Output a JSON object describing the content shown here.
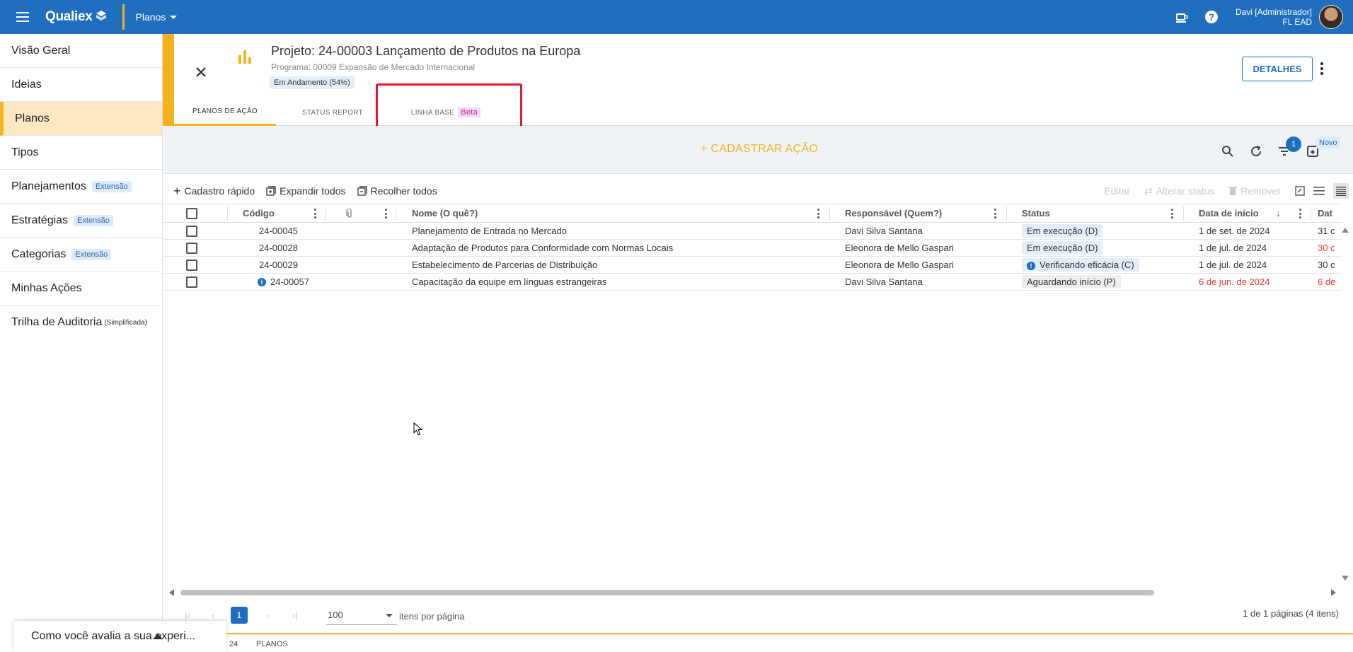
{
  "topbar": {
    "brand": "Qualiex",
    "module": "Planos",
    "user_name": "Davi [Administrador]",
    "user_org": "FL EAD",
    "icons": [
      "menu-icon",
      "coffee-icon",
      "help-icon"
    ]
  },
  "sidebar": {
    "items": [
      {
        "label": "Visão Geral",
        "badge": "",
        "note": ""
      },
      {
        "label": "Ideias",
        "badge": "",
        "note": ""
      },
      {
        "label": "Planos",
        "badge": "",
        "note": "",
        "active": true
      },
      {
        "label": "Tipos",
        "badge": "",
        "note": ""
      },
      {
        "label": "Planejamentos",
        "badge": "Extensão",
        "note": ""
      },
      {
        "label": "Estratégias",
        "badge": "Extensão",
        "note": ""
      },
      {
        "label": "Categorias",
        "badge": "Extensão",
        "note": ""
      },
      {
        "label": "Minhas Ações",
        "badge": "",
        "note": ""
      },
      {
        "label": "Trilha de Auditoria",
        "badge": "",
        "note": "(Simplificada)"
      }
    ]
  },
  "project": {
    "title": "Projeto: 24-00003 Lançamento de Produtos na Europa",
    "subtitle": "Programa: 00009 Expansão de Mercado Internacional",
    "status": "Em Andamento (54%)",
    "details_label": "DETALHES",
    "tabs": [
      {
        "label": "PLANOS DE AÇÃO",
        "active": true,
        "badge": ""
      },
      {
        "label": "STATUS REPORT",
        "active": false,
        "badge": ""
      },
      {
        "label": "LINHA BASE",
        "active": false,
        "badge": "Beta"
      }
    ]
  },
  "actions": {
    "cadastrar": "+ CADASTRAR AÇÃO",
    "filter_count": "1",
    "novo": "Novo"
  },
  "toolbar": {
    "quick_add": "Cadastro rápido",
    "expand_all": "Expandir todos",
    "collapse_all": "Recolher todos",
    "edit": "Editar",
    "change_status": "Alterar status",
    "remove": "Remover"
  },
  "grid": {
    "headers": {
      "code": "Código",
      "name": "Nome (O quê?)",
      "responsible": "Responsável (Quem?)",
      "status": "Status",
      "start": "Data de início",
      "end": "Dat"
    },
    "rows": [
      {
        "code": "24-00045",
        "name": "Planejamento de Entrada no Mercado",
        "responsible": "Davi Silva Santana",
        "status": "Em execução (D)",
        "start": "1 de set. de 2024",
        "end": "31 c",
        "start_late": false,
        "end_late": false,
        "info": false,
        "status_alert": false
      },
      {
        "code": "24-00028",
        "name": "Adaptação de Produtos para Conformidade com Normas Locais",
        "responsible": "Eleonora de Mello Gaspari",
        "status": "Em execução (D)",
        "start": "1 de jul. de 2024",
        "end": "30 c",
        "start_late": false,
        "end_late": true,
        "info": false,
        "status_alert": false
      },
      {
        "code": "24-00029",
        "name": "Estabelecimento de Parcerias de Distribuição",
        "responsible": "Eleonora de Mello Gaspari",
        "status": "Verificando eficácia (C)",
        "start": "1 de jul. de 2024",
        "end": "30 c",
        "start_late": false,
        "end_late": false,
        "info": false,
        "status_alert": true
      },
      {
        "code": "24-00057",
        "name": "Capacitação da equipe em línguas estrangeiras",
        "responsible": "Davi Silva Santana",
        "status": "Aguardando início (P)",
        "start": "6 de jun. de 2024",
        "end": "6 de",
        "start_late": true,
        "end_late": true,
        "info": true,
        "status_alert": false
      }
    ]
  },
  "pager": {
    "page": "1",
    "page_size": "100",
    "page_size_label": "itens por página",
    "summary": "1 de 1 páginas (4 itens)"
  },
  "bottom": {
    "label_left": "24",
    "label_right": "PLANOS"
  },
  "feedback": {
    "text": "Como você avalia a sua experi..."
  },
  "colors": {
    "brand_blue": "#1f6fbe",
    "accent_yellow": "#f6b21b",
    "highlight_red": "#e0182b"
  }
}
